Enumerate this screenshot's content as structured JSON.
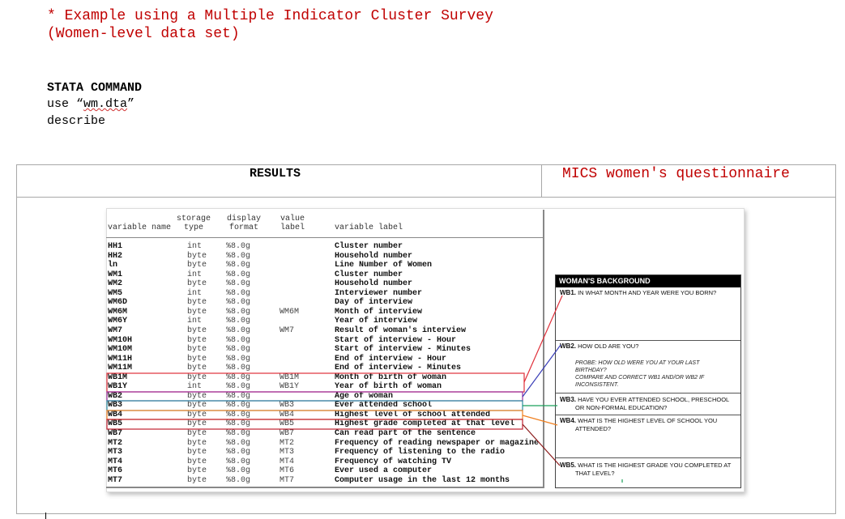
{
  "note": {
    "line1": "* Example using a Multiple Indicator Cluster Survey",
    "line2": "(Women-level data set)"
  },
  "command": {
    "heading": "STATA COMMAND",
    "line1_pre": "use “",
    "line1_file": "wm.dta",
    "line1_post": "”",
    "line2": "describe"
  },
  "table": {
    "results_title": "RESULTS",
    "mics_title": "MICS women's questionnaire"
  },
  "describe": {
    "headers": {
      "storage_1": "storage",
      "storage_2": "type",
      "display_1": "display",
      "display_2": "format",
      "value_1": "value",
      "value_2": "label",
      "varname": "variable name",
      "varlabel": "variable label"
    },
    "rows": [
      {
        "var": "HH1",
        "type": "int",
        "fmt": "%8.0g",
        "vl": "",
        "label": "Cluster number"
      },
      {
        "var": "HH2",
        "type": "byte",
        "fmt": "%8.0g",
        "vl": "",
        "label": "Household number"
      },
      {
        "var": "ln",
        "type": "byte",
        "fmt": "%8.0g",
        "vl": "",
        "label": "Line Number of Women"
      },
      {
        "var": "WM1",
        "type": "int",
        "fmt": "%8.0g",
        "vl": "",
        "label": "Cluster number"
      },
      {
        "var": "WM2",
        "type": "byte",
        "fmt": "%8.0g",
        "vl": "",
        "label": "Household number"
      },
      {
        "var": "WM5",
        "type": "int",
        "fmt": "%8.0g",
        "vl": "",
        "label": "Interviewer number"
      },
      {
        "var": "WM6D",
        "type": "byte",
        "fmt": "%8.0g",
        "vl": "",
        "label": "Day of interview"
      },
      {
        "var": "WM6M",
        "type": "byte",
        "fmt": "%8.0g",
        "vl": "WM6M",
        "label": "Month of interview"
      },
      {
        "var": "WM6Y",
        "type": "int",
        "fmt": "%8.0g",
        "vl": "",
        "label": "Year of interview"
      },
      {
        "var": "WM7",
        "type": "byte",
        "fmt": "%8.0g",
        "vl": "WM7",
        "label": "Result of woman's interview"
      },
      {
        "var": "WM10H",
        "type": "byte",
        "fmt": "%8.0g",
        "vl": "",
        "label": "Start of interview - Hour"
      },
      {
        "var": "WM10M",
        "type": "byte",
        "fmt": "%8.0g",
        "vl": "",
        "label": "Start of interview - Minutes"
      },
      {
        "var": "WM11H",
        "type": "byte",
        "fmt": "%8.0g",
        "vl": "",
        "label": "End of interview - Hour"
      },
      {
        "var": "WM11M",
        "type": "byte",
        "fmt": "%8.0g",
        "vl": "",
        "label": "End of interview - Minutes"
      },
      {
        "var": "WB1M",
        "type": "byte",
        "fmt": "%8.0g",
        "vl": "WB1M",
        "label": "Month of birth of woman"
      },
      {
        "var": "WB1Y",
        "type": "int",
        "fmt": "%8.0g",
        "vl": "WB1Y",
        "label": "Year of birth of woman"
      },
      {
        "var": "WB2",
        "type": "byte",
        "fmt": "%8.0g",
        "vl": "",
        "label": "Age of woman"
      },
      {
        "var": "WB3",
        "type": "byte",
        "fmt": "%8.0g",
        "vl": "WB3",
        "label": "Ever attended school"
      },
      {
        "var": "WB4",
        "type": "byte",
        "fmt": "%8.0g",
        "vl": "WB4",
        "label": "Highest level of school attended"
      },
      {
        "var": "WB5",
        "type": "byte",
        "fmt": "%8.0g",
        "vl": "WB5",
        "label": "Highest grade completed at that level"
      },
      {
        "var": "WB7",
        "type": "byte",
        "fmt": "%8.0g",
        "vl": "WB7",
        "label": "Can read part of the sentence"
      },
      {
        "var": "MT2",
        "type": "byte",
        "fmt": "%8.0g",
        "vl": "MT2",
        "label": "Frequency of reading newspaper or magazine"
      },
      {
        "var": "MT3",
        "type": "byte",
        "fmt": "%8.0g",
        "vl": "MT3",
        "label": "Frequency of listening to the radio"
      },
      {
        "var": "MT4",
        "type": "byte",
        "fmt": "%8.0g",
        "vl": "MT4",
        "label": "Frequency of watching TV"
      },
      {
        "var": "MT6",
        "type": "byte",
        "fmt": "%8.0g",
        "vl": "MT6",
        "label": "Ever used a computer"
      },
      {
        "var": "MT7",
        "type": "byte",
        "fmt": "%8.0g",
        "vl": "MT7",
        "label": "Computer usage in the last 12 months"
      }
    ]
  },
  "questionnaire": {
    "header": "WOMAN'S BACKGROUND",
    "wb1_code": "WB1.",
    "wb1_text": "IN WHAT MONTH AND YEAR WERE YOU BORN?",
    "wb2_code": "WB2.",
    "wb2_text": "HOW OLD ARE YOU?",
    "wb2_probe_1": "PROBE: HOW OLD WERE YOU AT YOUR LAST",
    "wb2_probe_2": "BIRTHDAY?",
    "wb2_probe_3": "COMPARE AND CORRECT WB1 AND/OR WB2 IF",
    "wb2_probe_4": "INCONSISTENT.",
    "wb3_code": "WB3.",
    "wb3_text_1": "HAVE YOU EVER ATTENDED SCHOOL, PRESCHOOL",
    "wb3_text_2": "OR NON-FORMAL EDUCATION?",
    "wb4_code": "WB4.",
    "wb4_text_1": "WHAT IS THE HIGHEST LEVEL OF SCHOOL YOU",
    "wb4_text_2": "ATTENDED?",
    "wb5_code": "WB5.",
    "wb5_text_1": "WHAT IS THE HIGHEST GRADE YOU COMPLETED AT",
    "wb5_text_2": "THAT LEVEL?"
  },
  "colors": {
    "note_red": "#c00000",
    "link_wb1": "#e0303a",
    "link_wb2": "#3b3fb8",
    "link_wb3": "#1aa05a",
    "link_wb4": "#f08020",
    "link_wb5": "#8b1a1a"
  }
}
